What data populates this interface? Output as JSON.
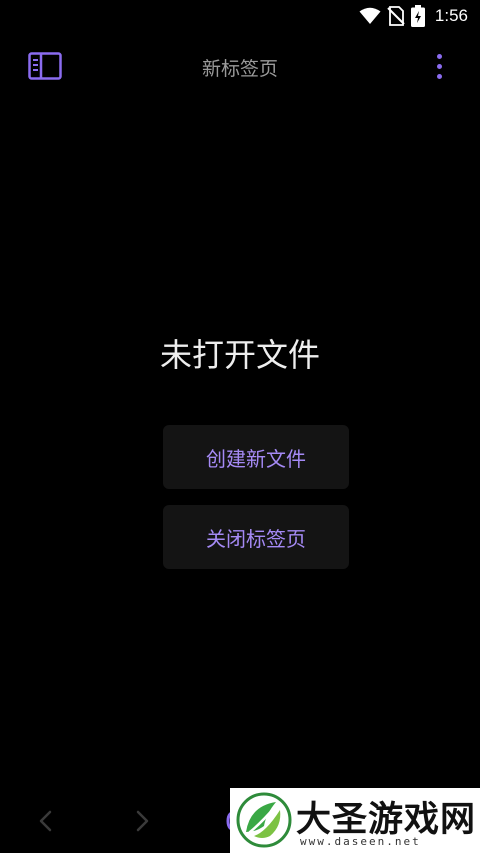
{
  "status_bar": {
    "time": "1:56",
    "icons": [
      "wifi-icon",
      "no-sim-icon",
      "battery-charging-icon"
    ]
  },
  "app_bar": {
    "title": "新标签页",
    "left_icon": "sidebar-toggle-icon",
    "right_icon": "more-vert-icon"
  },
  "empty_state": {
    "title": "未打开文件",
    "new_file_label": "创建新文件",
    "close_tab_label": "关闭标签页"
  },
  "bottom_nav": {
    "icons": [
      "chevron-left-icon",
      "chevron-right-icon"
    ]
  },
  "watermark": {
    "name": "大圣游戏网",
    "url": "www.daseen.net"
  },
  "colors": {
    "background": "#000000",
    "accent": "#8b6cf0",
    "button_text": "#a58af5",
    "button_bg": "#141414",
    "title_text": "#9a9a9a"
  }
}
